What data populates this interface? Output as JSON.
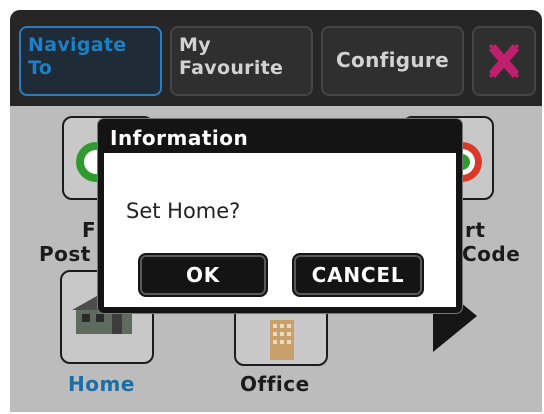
{
  "tabs": [
    {
      "label": "Navigate\nTo",
      "state": "selected"
    },
    {
      "label": "My\nFavourite"
    },
    {
      "label": "Configure"
    },
    {
      "icon": "close-icon"
    }
  ],
  "grid": {
    "items": [
      {
        "label_left": "F",
        "label_left2": "Post"
      },
      {
        "label_right": "rt",
        "label_right2": "Code"
      },
      {
        "label": "Home"
      },
      {
        "label": "Office"
      }
    ]
  },
  "dialog": {
    "title": "Information",
    "message": "Set Home?",
    "ok_label": "OK",
    "cancel_label": "CANCEL"
  },
  "colors": {
    "accent": "#1f7fc4",
    "close_pink": "#c0206e",
    "dialog_bar": "#141414"
  }
}
